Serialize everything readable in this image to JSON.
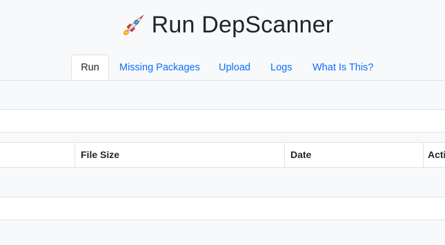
{
  "header": {
    "icon": "rocket-icon",
    "title": "Run DepScanner"
  },
  "tabs": [
    {
      "label": "Run",
      "active": true
    },
    {
      "label": "Missing Packages",
      "active": false
    },
    {
      "label": "Upload",
      "active": false
    },
    {
      "label": "Logs",
      "active": false
    },
    {
      "label": "What Is This?",
      "active": false
    }
  ],
  "table": {
    "columns": [
      "",
      "File Size",
      "Date",
      "Acti"
    ]
  },
  "colors": {
    "link": "#0d6efd",
    "text": "#212529",
    "background": "#f8f9fa",
    "border": "#dee2e6"
  }
}
